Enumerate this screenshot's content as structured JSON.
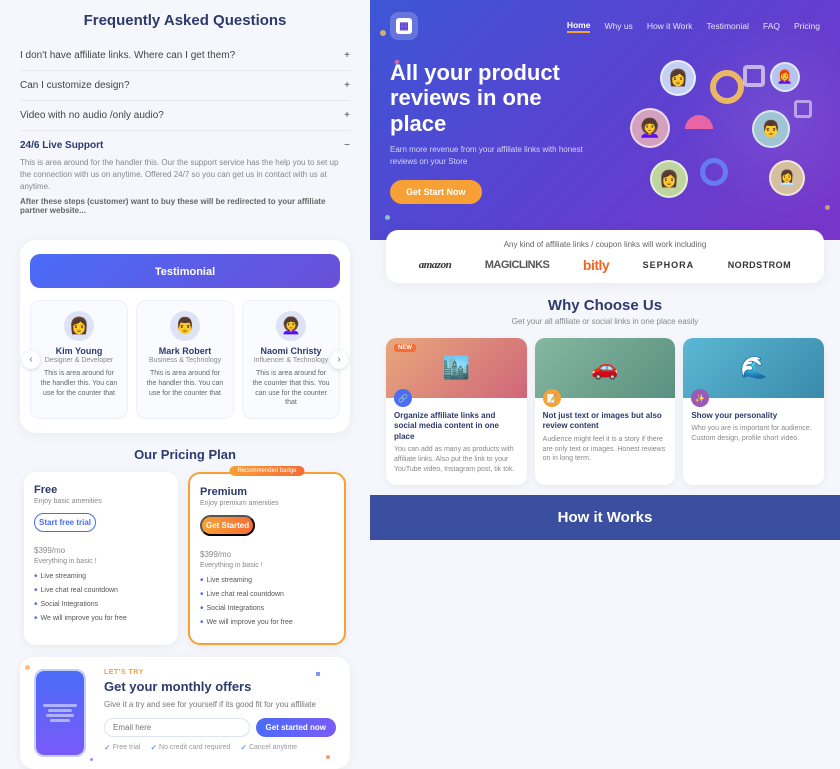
{
  "left": {
    "faq_title": "Frequently Asked Questions",
    "faq_items": [
      {
        "id": 1,
        "question": "I don't have affiliate links. Where can I get them?",
        "expanded": false,
        "icon": "plus"
      },
      {
        "id": 2,
        "question": "Can I customize design?",
        "expanded": false,
        "icon": "plus"
      },
      {
        "id": 3,
        "question": "Video with no audio /only audio?",
        "expanded": false,
        "icon": "plus"
      },
      {
        "id": 4,
        "question": "24/6 Live Support",
        "expanded": true,
        "icon": "minus",
        "content": "This is area around for the handler this. Our the support service has the help you to set up the connection with us on anytime. Offered 24/7 so you can get us in contact with us at anytime.",
        "sub": "After these steps (customer) want to buy these will be redirected to your affiliate partner website..."
      }
    ],
    "testimonial_title": "Testimonial",
    "testimonial_cards": [
      {
        "name": "Kim Young",
        "role": "Designer & Developer",
        "text": "This is area around for the handler this. You can use for the counter that",
        "avatar": "👩"
      },
      {
        "name": "Mark Robert",
        "role": "Business & Technology",
        "text": "This is area around for the handler this. You can use for the counter that",
        "avatar": "👨"
      },
      {
        "name": "Naomi Christy",
        "role": "Influencer & Technology",
        "text": "This is area around for the counter that this. You can use for the counter that",
        "avatar": "👩‍🦱"
      }
    ],
    "pricing_title": "Our Pricing Plan",
    "pricing_plans": [
      {
        "type": "Free",
        "desc": "Enjoy basic amenities",
        "btn": "Start free trial",
        "btn_type": "free",
        "price": "$399/mo",
        "subtitle": "Everything in basic !",
        "features": [
          "Live streaming",
          "Live chat real countdown",
          "Social Integrations",
          "We will improve you for free"
        ],
        "popular": false
      },
      {
        "type": "Premium",
        "desc": "Enjoy premium amenities",
        "btn": "Get Started",
        "btn_type": "premium",
        "price": "$399/mo",
        "subtitle": "Everything in basic !",
        "features": [
          "Live streaming",
          "Live chat real countdown",
          "Social Integrations",
          "We will improve you for free"
        ],
        "popular": true,
        "badge": "Recommended badge"
      }
    ],
    "cta": {
      "label": "LET'S TRY",
      "heading": "Get your monthly offers",
      "sub": "Give it a try and see for yourself if its good fit for you affiliate",
      "email_placeholder": "Email here",
      "submit_label": "Get started now",
      "notes": [
        "Free trial",
        "No credit card required",
        "Cancel anytime"
      ]
    }
  },
  "right": {
    "nav": {
      "links": [
        "Home",
        "Why us",
        "How it Work",
        "Testimonial",
        "FAQ",
        "Pricing"
      ],
      "active_index": 0
    },
    "hero": {
      "title": "All your product reviews in one place",
      "sub": "Earn more revenue from your affiliate links with honest reviews on your Store",
      "cta": "Get Start Now"
    },
    "partners": {
      "title": "Any kind of affiliate links / coupon links will work including",
      "logos": [
        "amazon",
        "MAGICLINKS",
        "bitly",
        "SEPHORA",
        "NORDSTROM"
      ]
    },
    "why": {
      "title": "Why Choose Us",
      "sub": "Get your all affiliate or social links in one place easily",
      "cards": [
        {
          "img_type": "urban",
          "tag": "NEW",
          "icon": "🔗",
          "icon_bg": "#4a6cf7",
          "title": "Organize affiliate links and social media content in one place",
          "desc": "You can add as many as products with affiliate links. Also put the link to your YouTube video, Instagram post, tik tok."
        },
        {
          "img_type": "car",
          "tag": null,
          "icon": "📝",
          "icon_bg": "#f7a035",
          "title": "Not just text or images but also review content",
          "desc": "Audience might feel it is a story if there are only text or images. Honest reviews on in long term."
        },
        {
          "img_type": "ocean",
          "tag": null,
          "icon": "✨",
          "icon_bg": "#9b59b6",
          "title": "Show your personality",
          "desc": "Who you are is important for audience. Custom design, profile short video."
        }
      ]
    },
    "how": {
      "title": "How it Works"
    }
  }
}
